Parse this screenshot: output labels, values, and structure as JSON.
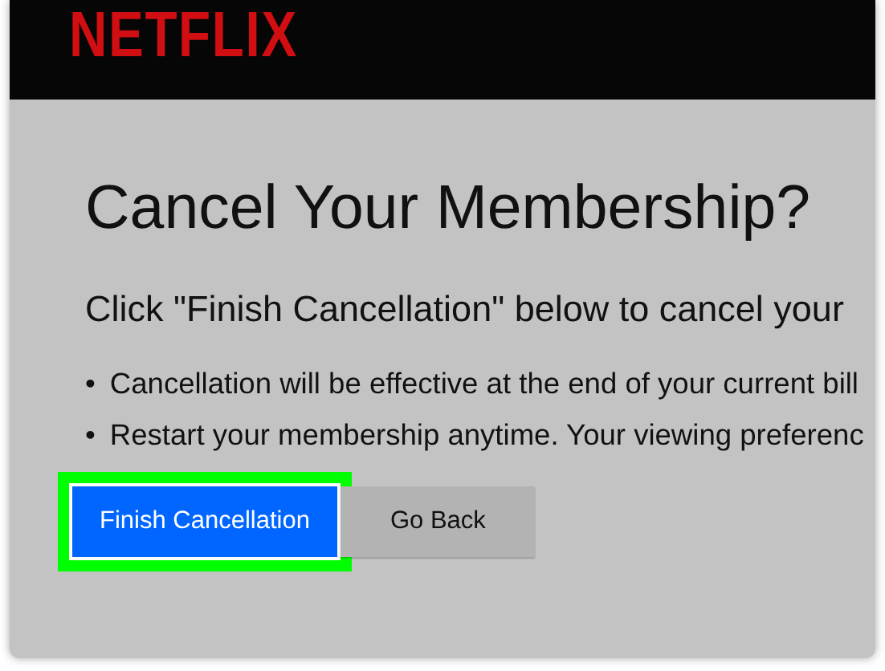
{
  "header": {
    "logo": "NETFLIX"
  },
  "title": "Cancel Your Membership?",
  "subtitle": "Click \"Finish Cancellation\" below to cancel your",
  "bullets": [
    {
      "marker": "•",
      "text": "Cancellation will be effective at the end of your current bill"
    },
    {
      "marker": "•",
      "text": "Restart your membership anytime. Your viewing preferenc"
    }
  ],
  "buttons": [
    {
      "label": "Finish Cancellation",
      "kind": "primary",
      "highlighted": true
    },
    {
      "label": "Go Back",
      "kind": "secondary",
      "highlighted": false
    }
  ]
}
